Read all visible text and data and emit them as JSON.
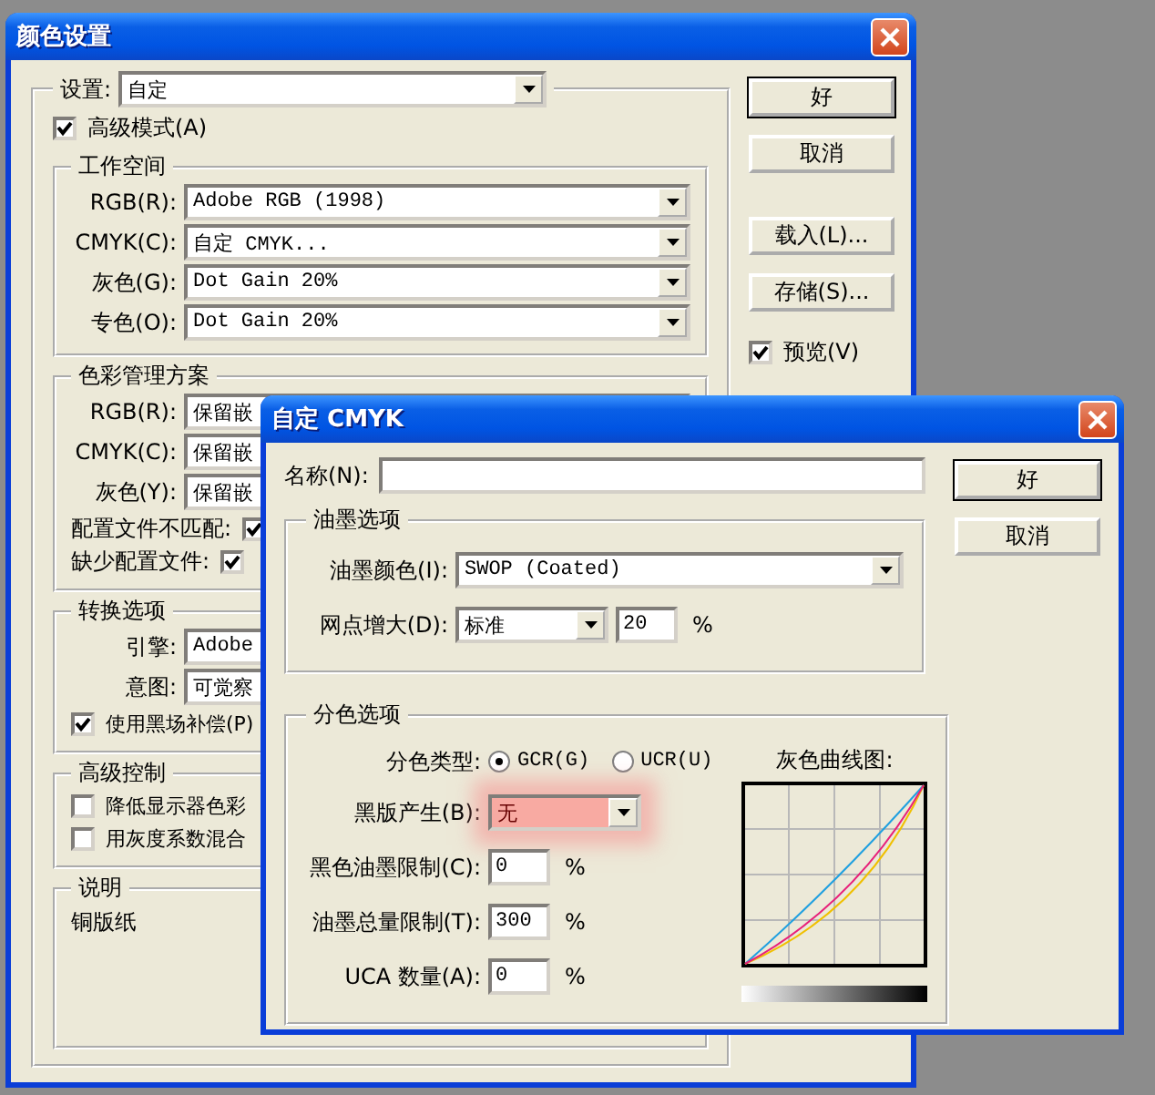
{
  "main_dialog": {
    "title": "颜色设置",
    "settings": {
      "label": "设置:",
      "value": "自定"
    },
    "advanced_mode": {
      "label": "高级模式(A)",
      "checked": true
    },
    "groups": [
      {
        "title": "工作空间",
        "rows": [
          {
            "kind": "select",
            "label": "RGB(R):",
            "value": "Adobe RGB (1998)"
          },
          {
            "kind": "select",
            "label": "CMYK(C):",
            "value": "自定 CMYK..."
          },
          {
            "kind": "select",
            "label": "灰色(G):",
            "value": "Dot Gain 20%"
          },
          {
            "kind": "select",
            "label": "专色(O):",
            "value": "Dot Gain 20%"
          }
        ]
      },
      {
        "title": "色彩管理方案",
        "rows": [
          {
            "kind": "select",
            "label": "RGB(R):",
            "value": "保留嵌"
          },
          {
            "kind": "select",
            "label": "CMYK(C):",
            "value": "保留嵌"
          },
          {
            "kind": "select",
            "label": "灰色(Y):",
            "value": "保留嵌"
          },
          {
            "kind": "labeled_check",
            "label": "配置文件不匹配:",
            "checked": true
          },
          {
            "kind": "labeled_check",
            "label": "缺少配置文件:",
            "checked": true
          }
        ]
      },
      {
        "title": "转换选项",
        "rows": [
          {
            "kind": "select",
            "label": "引擎:",
            "value": "Adobe"
          },
          {
            "kind": "select",
            "label": "意图:",
            "value": "可觉察"
          },
          {
            "kind": "checkbox",
            "label": "使用黑场补偿(P)",
            "checked": true
          }
        ]
      },
      {
        "title": "高级控制",
        "rows": [
          {
            "kind": "checkbox",
            "label": "降低显示器色彩",
            "checked": false
          },
          {
            "kind": "checkbox",
            "label": "用灰度系数混合",
            "checked": false
          }
        ]
      },
      {
        "title": "说明",
        "rows": [
          {
            "kind": "text",
            "text": "铜版纸"
          }
        ]
      }
    ],
    "buttons": [
      {
        "label": "好",
        "default": true
      },
      {
        "label": "取消",
        "default": false
      },
      {
        "label": "载入(L)...",
        "default": false
      },
      {
        "label": "存储(S)...",
        "default": false
      }
    ],
    "preview": {
      "label": "预览(V)",
      "checked": true
    }
  },
  "cmyk_dialog": {
    "title": "自定 CMYK",
    "name_field": {
      "label": "名称(N):"
    },
    "buttons": [
      {
        "label": "好",
        "default": true
      },
      {
        "label": "取消",
        "default": false
      }
    ],
    "ink_options": {
      "title": "油墨选项",
      "ink_colors": {
        "label": "油墨颜色(I):",
        "value": "SWOP (Coated)"
      },
      "dot_gain": {
        "label": "网点增大(D):",
        "value": "标准",
        "amount": "20",
        "unit": "%"
      }
    },
    "separation_options": {
      "title": "分色选项",
      "type": {
        "label": "分色类型:",
        "options": [
          {
            "label": "GCR(G)",
            "selected": true
          },
          {
            "label": "UCR(U)",
            "selected": false
          }
        ]
      },
      "black_generation": {
        "label": "黑版产生(B):",
        "value": "无",
        "highlighted": true
      },
      "fields": [
        {
          "label": "黑色油墨限制(C):",
          "value": "0",
          "unit": "%"
        },
        {
          "label": "油墨总量限制(T):",
          "value": "300",
          "unit": "%"
        },
        {
          "label": "UCA 数量(A):",
          "value": "0",
          "unit": "%"
        }
      ],
      "curve_label": "灰色曲线图:"
    }
  }
}
